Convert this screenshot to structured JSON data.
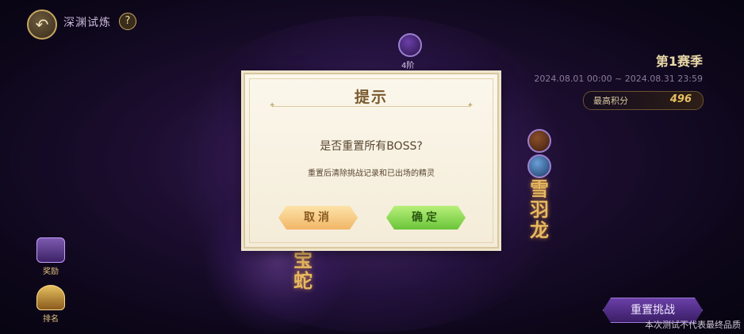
{
  "header": {
    "title": "深渊试炼",
    "back_icon": "back-arrow-icon",
    "help_label": "?"
  },
  "season": {
    "title": "第1赛季",
    "dates": "2024.08.01 00:00 ~ 2024.08.31 23:59",
    "best_score_label": "最高积分",
    "best_score_value": "496"
  },
  "bosses": {
    "right_name": "雪羽龙",
    "bottom_name": "天宝蛇",
    "top_tag": "4阶"
  },
  "side_buttons": [
    {
      "label": "奖励",
      "icon": "gift-box-icon"
    },
    {
      "label": "排名",
      "icon": "trophy-icon"
    }
  ],
  "reset_button": {
    "label": "重置挑战"
  },
  "disclaimer": "本次测试不代表最终品质",
  "dialog": {
    "title": "提示",
    "question": "是否重置所有BOSS?",
    "detail": "重置后清除挑战记录和已出场的精灵",
    "cancel_label": "取消",
    "confirm_label": "确定"
  },
  "colors": {
    "background": "#2c1648",
    "dialog_bg": "#f8f2e2",
    "cancel_button": "#f1b667",
    "confirm_button": "#6ac43a",
    "accent_gold": "#e8c060"
  }
}
